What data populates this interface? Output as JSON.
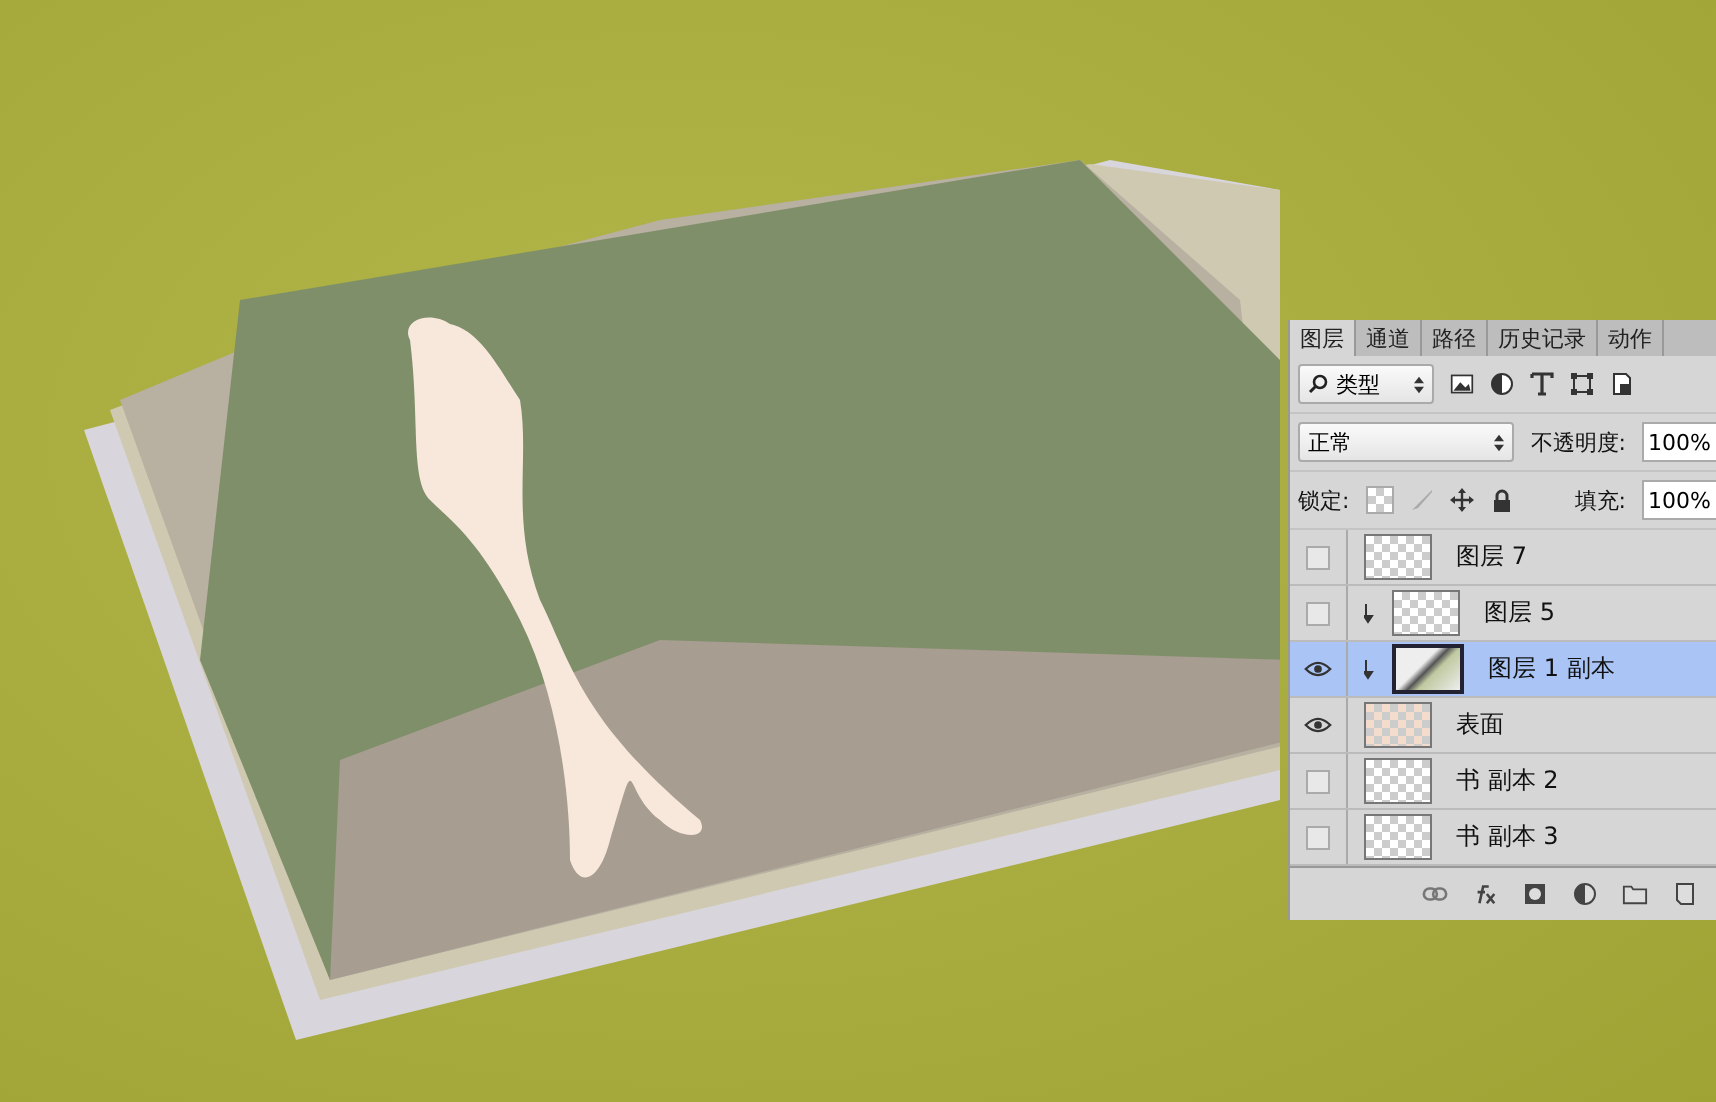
{
  "layers_panel": {
    "tabs": [
      {
        "label": "图层",
        "selected": true
      },
      {
        "label": "通道",
        "selected": false
      },
      {
        "label": "路径",
        "selected": false
      },
      {
        "label": "历史记录",
        "selected": false
      },
      {
        "label": "动作",
        "selected": false
      }
    ],
    "filter": {
      "value": "类型"
    },
    "blend_mode": {
      "value": "正常"
    },
    "opacity": {
      "label": "不透明度:",
      "value": "100%"
    },
    "lock": {
      "label": "锁定:"
    },
    "fill": {
      "label": "填充:",
      "value": "100%"
    },
    "layers": [
      {
        "name": "图层 7",
        "visible": false,
        "clipped": false,
        "selected": false,
        "kind": "transparent"
      },
      {
        "name": "图层 5",
        "visible": false,
        "clipped": true,
        "selected": false,
        "kind": "transparent"
      },
      {
        "name": "图层 1 副本",
        "visible": true,
        "clipped": true,
        "selected": true,
        "kind": "smart"
      },
      {
        "name": "表面",
        "visible": true,
        "clipped": false,
        "selected": false,
        "kind": "skin"
      },
      {
        "name": "书 副本 2",
        "visible": false,
        "clipped": false,
        "selected": false,
        "kind": "transparent"
      },
      {
        "name": "书 副本 3",
        "visible": false,
        "clipped": false,
        "selected": false,
        "kind": "transparent"
      }
    ]
  }
}
